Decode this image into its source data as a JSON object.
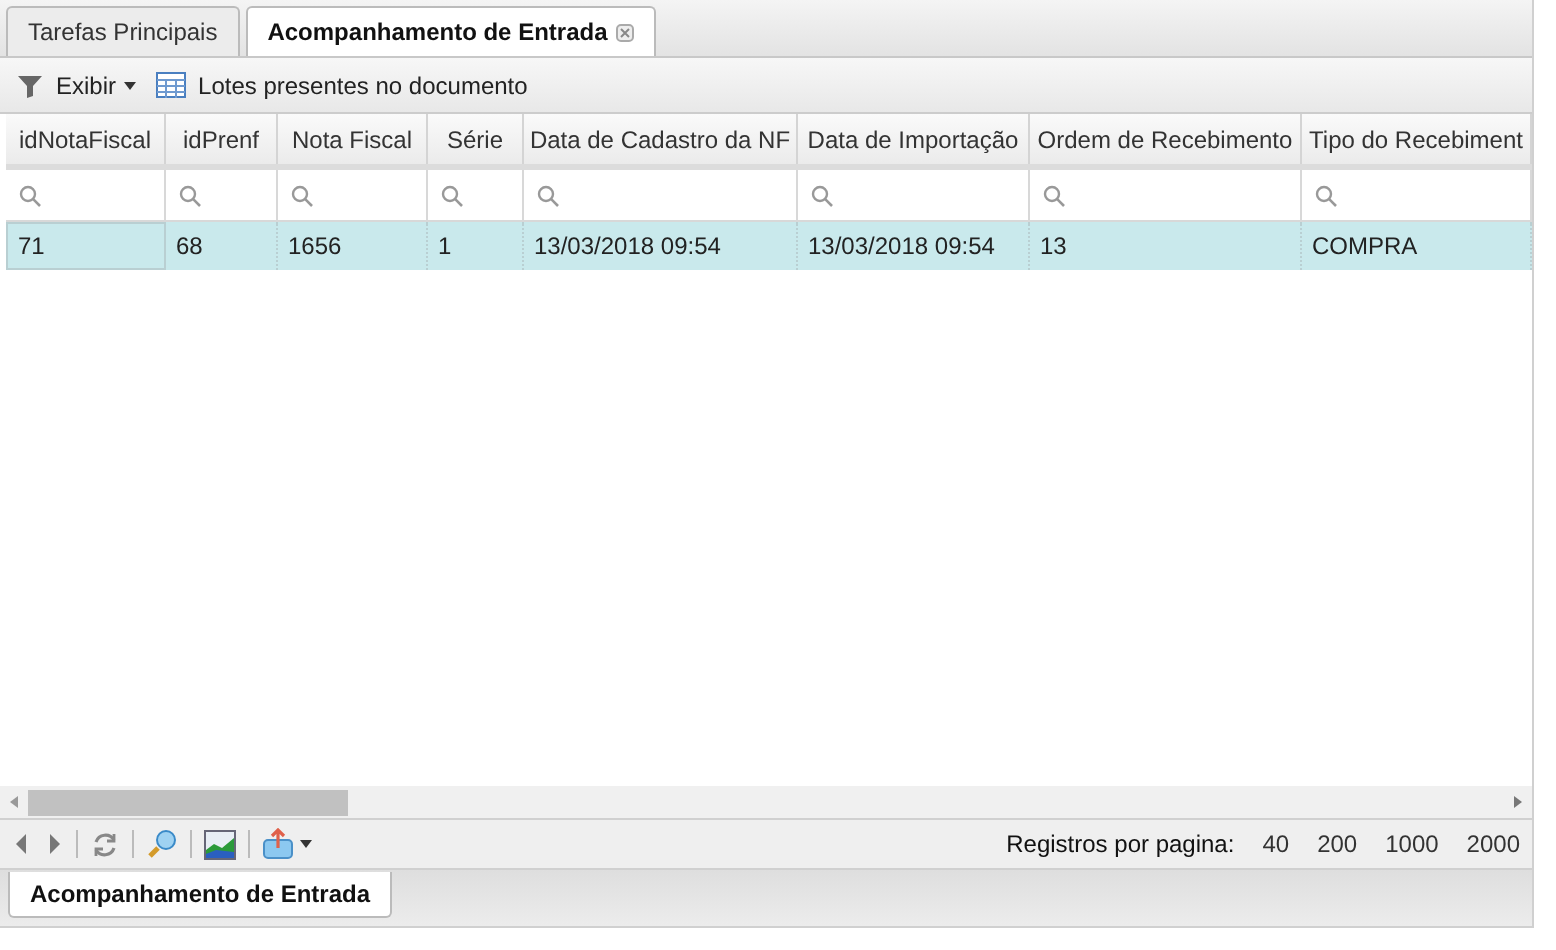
{
  "tabs": [
    {
      "label": "Tarefas Principais",
      "selected": false,
      "closable": false
    },
    {
      "label": "Acompanhamento de Entrada",
      "selected": true,
      "closable": true
    }
  ],
  "toolbar": {
    "view_menu": "Exibir",
    "lots_button": "Lotes presentes no documento"
  },
  "table": {
    "columns": [
      "idNotaFiscal",
      "idPrenf",
      "Nota Fiscal",
      "Série",
      "Data de Cadastro da NF",
      "Data de Importação",
      "Ordem de Recebimento",
      "Tipo do Recebiment"
    ],
    "rows": [
      {
        "selected": true,
        "cells": [
          "71",
          "68",
          "1656",
          "1",
          "13/03/2018 09:54",
          "13/03/2018 09:54",
          "13",
          "COMPRA"
        ]
      }
    ]
  },
  "pager": {
    "label": "Registros por pagina:",
    "page_sizes": [
      "40",
      "200",
      "1000",
      "2000"
    ]
  },
  "bottom_tabs": [
    {
      "label": "Acompanhamento de Entrada",
      "selected": true
    }
  ]
}
